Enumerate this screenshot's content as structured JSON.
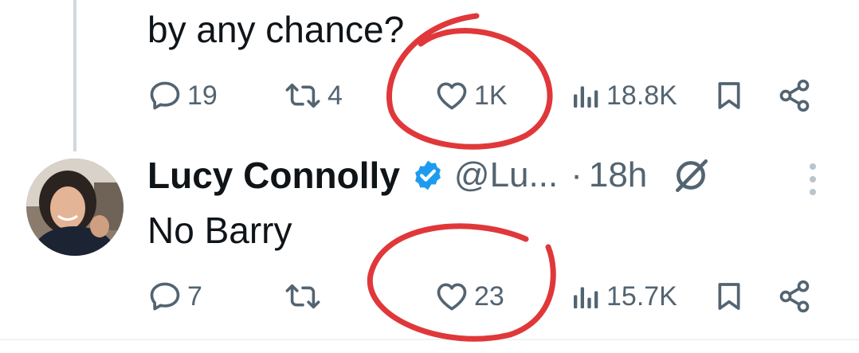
{
  "tweet1": {
    "text": "by any chance?",
    "reply_count": "19",
    "retweet_count": "4",
    "like_count": "1K",
    "view_count": "18.8K"
  },
  "tweet2": {
    "author_name": "Lucy Connolly",
    "handle": "@Lu...",
    "separator": "·",
    "time": "18h",
    "text": "No Barry",
    "reply_count": "7",
    "like_count": "23",
    "view_count": "15.7K"
  },
  "colors": {
    "text": "#0f1419",
    "muted": "#536471",
    "verified": "#1d9bf0",
    "annotation": "#e0383a"
  },
  "icons": [
    "reply-icon",
    "retweet-icon",
    "like-icon",
    "views-icon",
    "bookmark-icon",
    "share-icon",
    "verified-badge-icon",
    "grok-icon",
    "more-icon"
  ]
}
